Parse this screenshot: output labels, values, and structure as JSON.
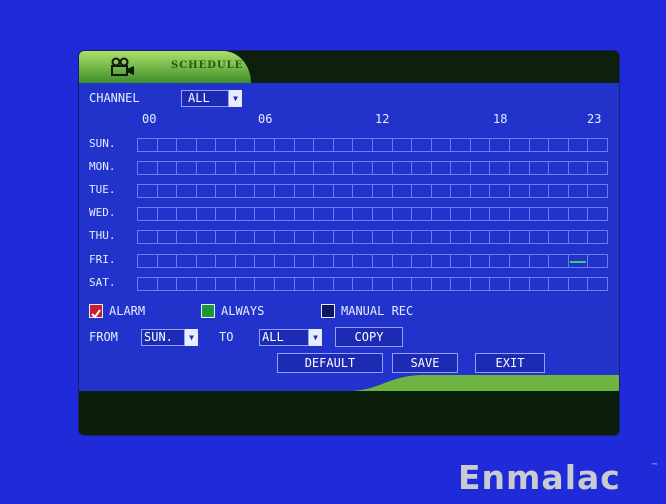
{
  "panel": {
    "title": "SCHEDULE"
  },
  "channel": {
    "label": "CHANNEL",
    "value": "ALL"
  },
  "hours": [
    "00",
    "06",
    "12",
    "18",
    "23"
  ],
  "days": [
    "SUN.",
    "MON.",
    "TUE.",
    "WED.",
    "THU.",
    "FRI.",
    "SAT."
  ],
  "schedule": {
    "slots_per_day": 24,
    "active": [
      {
        "day": "FRI.",
        "hour": 22,
        "mode": "always"
      }
    ]
  },
  "legend": [
    {
      "label": "ALARM",
      "color": "#c8202a",
      "checked": true
    },
    {
      "label": "ALWAYS",
      "color": "#1c9a35"
    },
    {
      "label": "MANUAL REC",
      "color": "#101560"
    }
  ],
  "copy": {
    "from_label": "FROM",
    "from_value": "SUN.",
    "to_label": "TO",
    "to_value": "ALL",
    "copy_label": "COPY"
  },
  "buttons": {
    "default": "DEFAULT",
    "save": "SAVE",
    "exit": "EXIT"
  },
  "brand": {
    "name": "Enmalac",
    "tm": "™"
  },
  "colors": {
    "background": "#1f2ad8",
    "panel": "#2233cc",
    "header_accent": "#7cc84a",
    "active_slot": "#3bd06a"
  }
}
